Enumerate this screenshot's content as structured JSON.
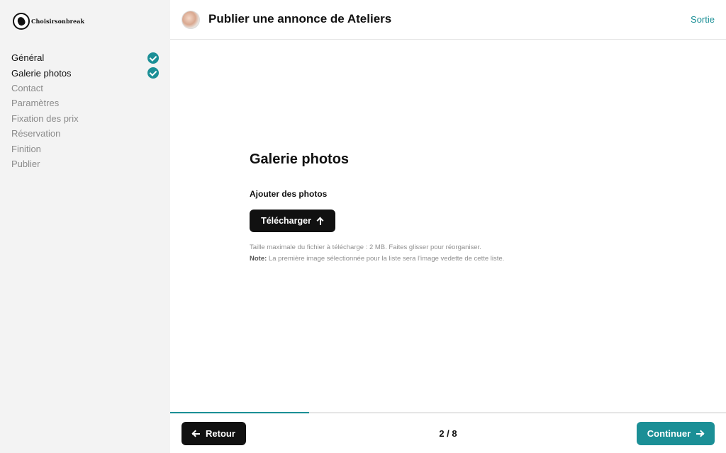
{
  "brand": {
    "logo_text": "Choisirsonbreak",
    "logo_icon": "leaf-globe-icon"
  },
  "sidebar": {
    "items": [
      {
        "label": "Général",
        "done": true
      },
      {
        "label": "Galerie photos",
        "done": true
      },
      {
        "label": "Contact",
        "done": false
      },
      {
        "label": "Paramètres",
        "done": false
      },
      {
        "label": "Fixation des prix",
        "done": false
      },
      {
        "label": "Réservation",
        "done": false
      },
      {
        "label": "Finition",
        "done": false
      },
      {
        "label": "Publier",
        "done": false
      }
    ]
  },
  "header": {
    "title": "Publier une annonce de Ateliers",
    "exit_label": "Sortie"
  },
  "main": {
    "section_title": "Galerie photos",
    "field_label": "Ajouter des photos",
    "upload_label": "Télécharger",
    "hint_line1": "Taille maximale du fichier à télécharge : 2 MB. Faites glisser pour réorganiser.",
    "hint_note_label": "Note:",
    "hint_note_text": "La première image sélectionnée pour la liste sera l'image vedette de cette liste."
  },
  "footer": {
    "back_label": "Retour",
    "pager": "2 / 8",
    "progress": 0.25,
    "next_label": "Continuer"
  },
  "colors": {
    "accent": "#1b8f96",
    "dark_button": "#111111",
    "sidebar_bg": "#f3f3f3"
  }
}
